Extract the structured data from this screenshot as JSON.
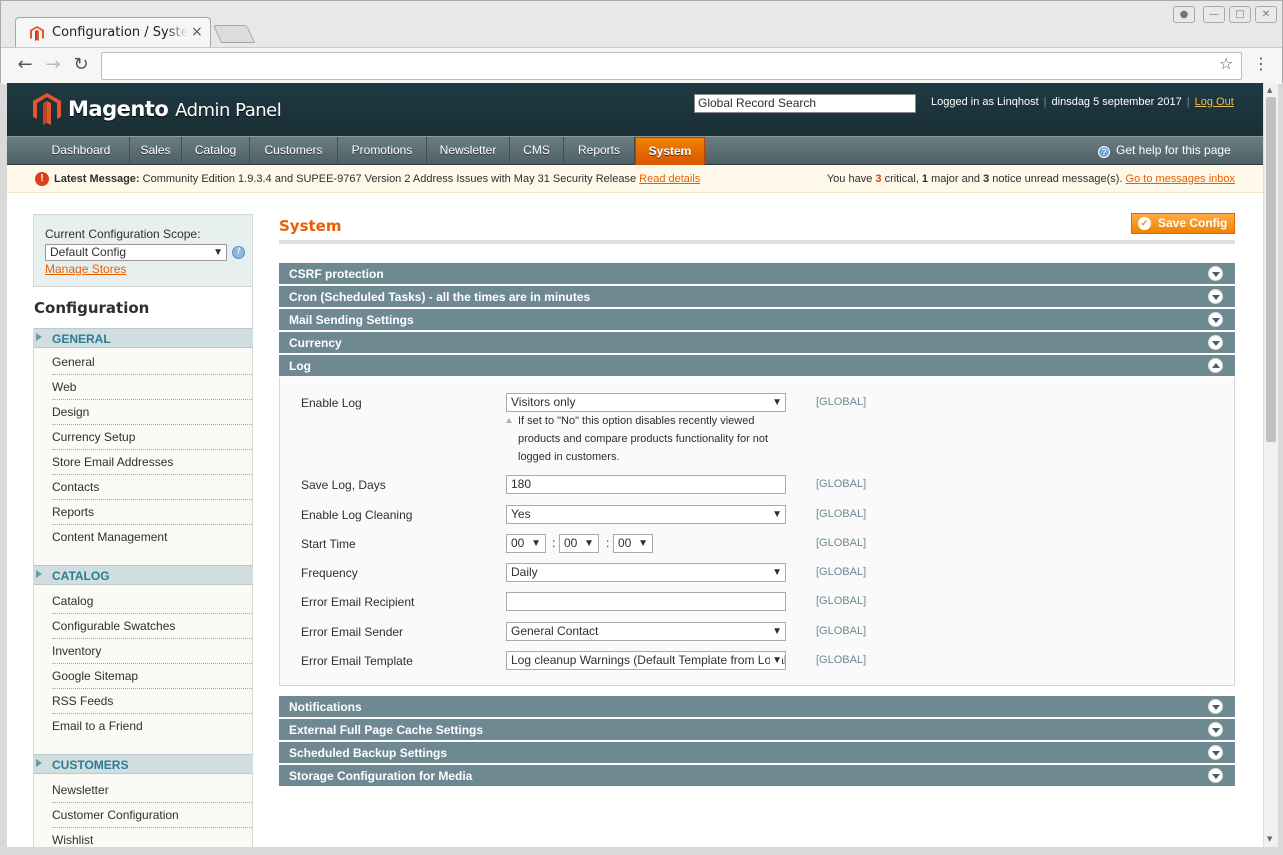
{
  "browser": {
    "tab_title": "Configuration / System",
    "tab_close": "×",
    "url": ""
  },
  "header": {
    "logo_main": "Magento",
    "logo_sub": "Admin Panel",
    "search_value": "Global Record Search",
    "logged_in": "Logged in as Linqhost",
    "date": "dinsdag 5 september 2017",
    "logout": "Log Out"
  },
  "nav": {
    "items": [
      "Dashboard",
      "Sales",
      "Catalog",
      "Customers",
      "Promotions",
      "Newsletter",
      "CMS",
      "Reports",
      "System"
    ],
    "active": "System",
    "help": "Get help for this page"
  },
  "notice": {
    "label": "Latest Message:",
    "text": "Community Edition 1.9.3.4 and SUPEE-9767 Version 2 Address Issues with May 31 Security Release",
    "read_details": "Read details",
    "summary_prefix": "You have",
    "critical_count": "3",
    "critical_label": "critical,",
    "major_count": "1",
    "major_label": "major and",
    "notice_count": "3",
    "notice_label": "notice unread message(s).",
    "inbox_link": "Go to messages inbox"
  },
  "sidebar": {
    "scope_label": "Current Configuration Scope:",
    "scope_value": "Default Config",
    "manage_stores": "Manage Stores",
    "title": "Configuration",
    "sections": [
      {
        "title": "GENERAL",
        "items": [
          "General",
          "Web",
          "Design",
          "Currency Setup",
          "Store Email Addresses",
          "Contacts",
          "Reports",
          "Content Management"
        ]
      },
      {
        "title": "CATALOG",
        "items": [
          "Catalog",
          "Configurable Swatches",
          "Inventory",
          "Google Sitemap",
          "RSS Feeds",
          "Email to a Friend"
        ]
      },
      {
        "title": "CUSTOMERS",
        "items": [
          "Newsletter",
          "Customer Configuration",
          "Wishlist"
        ]
      }
    ]
  },
  "main": {
    "title": "System",
    "save_button": "Save Config",
    "fieldsets_top": [
      "CSRF protection",
      "Cron (Scheduled Tasks) - all the times are in minutes",
      "Mail Sending Settings",
      "Currency",
      "Log"
    ],
    "fieldsets_bottom": [
      "Notifications",
      "External Full Page Cache Settings",
      "Scheduled Backup Settings",
      "Storage Configuration for Media"
    ],
    "log": {
      "scope": "[GLOBAL]",
      "enable_log_label": "Enable Log",
      "enable_log_value": "Visitors only",
      "enable_log_note": "If set to \"No\" this option disables recently viewed products and compare products functionality for not logged in customers.",
      "save_days_label": "Save Log, Days",
      "save_days_value": "180",
      "cleaning_label": "Enable Log Cleaning",
      "cleaning_value": "Yes",
      "start_time_label": "Start Time",
      "start_hour": "00",
      "start_min": "00",
      "start_sec": "00",
      "time_sep": ":",
      "frequency_label": "Frequency",
      "frequency_value": "Daily",
      "recipient_label": "Error Email Recipient",
      "recipient_value": "",
      "sender_label": "Error Email Sender",
      "sender_value": "General Contact",
      "template_label": "Error Email Template",
      "template_value": "Log cleanup Warnings (Default Template from Locale)"
    }
  }
}
